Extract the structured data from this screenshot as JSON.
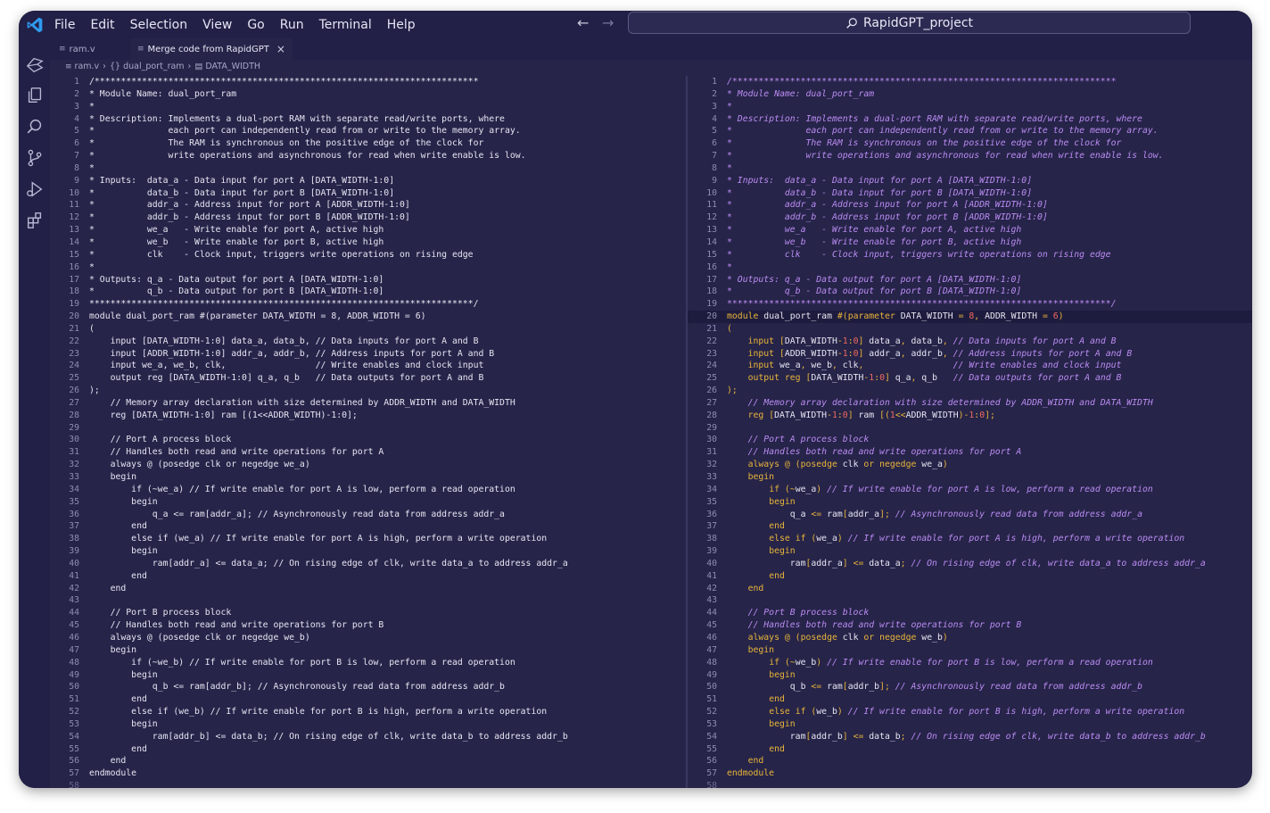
{
  "menu": [
    "File",
    "Edit",
    "Selection",
    "View",
    "Go",
    "Run",
    "Terminal",
    "Help"
  ],
  "search": {
    "text": "RapidGPT_project"
  },
  "tabs": [
    {
      "label": "ram.v"
    },
    {
      "label": "Merge code from RapidGPT",
      "close": "×"
    }
  ],
  "breadcrumb": {
    "file": "ram.v",
    "module": "dual_port_ram",
    "symbol": "DATA_WIDTH"
  },
  "colors": {
    "background": "#262449",
    "keyword": "#e8b53a",
    "number": "#f06a5e",
    "comment": "#bb8cf3",
    "plain": "#e6e6f2"
  },
  "code_lines": [
    "/*************************************************************************",
    "* Module Name: dual_port_ram",
    "*",
    "* Description: Implements a dual-port RAM with separate read/write ports, where",
    "*              each port can independently read from or write to the memory array.",
    "*              The RAM is synchronous on the positive edge of the clock for",
    "*              write operations and asynchronous for read when write enable is low.",
    "*",
    "* Inputs:  data_a - Data input for port A [DATA_WIDTH-1:0]",
    "*          data_b - Data input for port B [DATA_WIDTH-1:0]",
    "*          addr_a - Address input for port A [ADDR_WIDTH-1:0]",
    "*          addr_b - Address input for port B [ADDR_WIDTH-1:0]",
    "*          we_a   - Write enable for port A, active high",
    "*          we_b   - Write enable for port B, active high",
    "*          clk    - Clock input, triggers write operations on rising edge",
    "*",
    "* Outputs: q_a - Data output for port A [DATA_WIDTH-1:0]",
    "*          q_b - Data output for port B [DATA_WIDTH-1:0]",
    "*************************************************************************/",
    "module dual_port_ram #(parameter DATA_WIDTH = 8, ADDR_WIDTH = 6)",
    "(",
    "    input [DATA_WIDTH-1:0] data_a, data_b, // Data inputs for port A and B",
    "    input [ADDR_WIDTH-1:0] addr_a, addr_b, // Address inputs for port A and B",
    "    input we_a, we_b, clk,                 // Write enables and clock input",
    "    output reg [DATA_WIDTH-1:0] q_a, q_b   // Data outputs for port A and B",
    ");",
    "    // Memory array declaration with size determined by ADDR_WIDTH and DATA_WIDTH",
    "    reg [DATA_WIDTH-1:0] ram [(1<<ADDR_WIDTH)-1:0];",
    "",
    "    // Port A process block",
    "    // Handles both read and write operations for port A",
    "    always @ (posedge clk or negedge we_a)",
    "    begin",
    "        if (~we_a) // If write enable for port A is low, perform a read operation",
    "        begin",
    "            q_a <= ram[addr_a]; // Asynchronously read data from address addr_a",
    "        end",
    "        else if (we_a) // If write enable for port A is high, perform a write operation",
    "        begin",
    "            ram[addr_a] <= data_a; // On rising edge of clk, write data_a to address addr_a",
    "        end",
    "    end",
    "",
    "    // Port B process block",
    "    // Handles both read and write operations for port B",
    "    always @ (posedge clk or negedge we_b)",
    "    begin",
    "        if (~we_b) // If write enable for port B is low, perform a read operation",
    "        begin",
    "            q_b <= ram[addr_b]; // Asynchronously read data from address addr_b",
    "        end",
    "        else if (we_b) // If write enable for port B is high, perform a write operation",
    "        begin",
    "            ram[addr_b] <= data_b; // On rising edge of clk, write data_b to address addr_b",
    "        end",
    "    end",
    "endmodule"
  ],
  "trailing_line_number": "58"
}
